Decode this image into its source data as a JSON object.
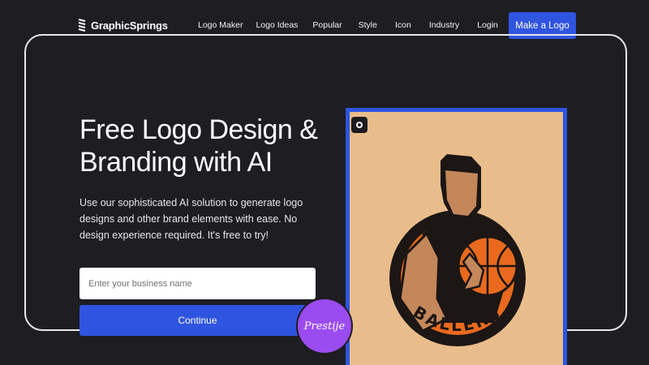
{
  "header": {
    "brand": "GraphicSprings",
    "nav": [
      "Logo Maker",
      "Logo Ideas",
      "Popular",
      "Style",
      "Icon",
      "Industry",
      "Login"
    ],
    "cta_label": "Make a Logo"
  },
  "hero": {
    "headline": "Free Logo Design & Branding with AI",
    "subtext": "Use our sophisticated AI solution to generate logo designs and other brand elements with ease. No design experience required. It's free to try!",
    "input_placeholder": "Enter your business name",
    "continue_label": "Continue"
  },
  "preview": {
    "logo_text": "BALLERS",
    "badge_icon": "pause-icon"
  },
  "watermark": "Prestije",
  "colors": {
    "background": "#1e1d22",
    "accent": "#2f54e0",
    "preview_bg": "#e9bd8b",
    "ball": "#e96a1e",
    "watermark": "#9b4cf0"
  }
}
